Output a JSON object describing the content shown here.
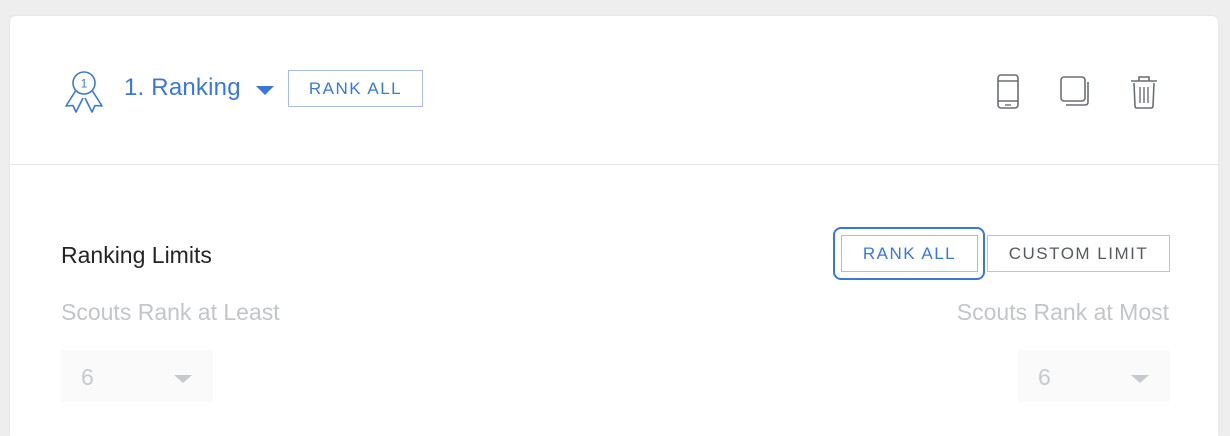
{
  "header": {
    "question_title": "1. Ranking",
    "rank_all_label": "RANK ALL",
    "icons": [
      "award-icon",
      "chevron-down-icon",
      "mobile-preview-icon",
      "duplicate-icon",
      "trash-icon"
    ]
  },
  "ranking_limits": {
    "title": "Ranking Limits",
    "rank_all_label": "RANK ALL",
    "custom_limit_label": "CUSTOM LIMIT",
    "selected": "RANK ALL",
    "min": {
      "label": "Scouts Rank at Least",
      "value": "6"
    },
    "max": {
      "label": "Scouts Rank at Most",
      "value": "6"
    }
  },
  "colors": {
    "accent": "#3a78d6",
    "text": "#222426",
    "muted": "#c2c5c9",
    "icon": "#6b6f75"
  }
}
